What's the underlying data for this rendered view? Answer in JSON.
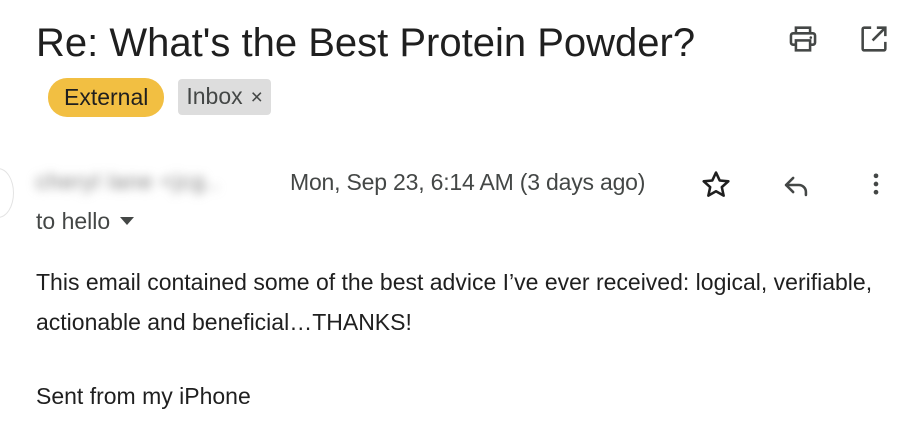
{
  "email": {
    "subject": "Re: What's the Best Protein Powder?",
    "labels": {
      "external": "External",
      "inbox": "Inbox",
      "remove_symbol": "×"
    },
    "sender_name": "cheryl lane <jcg..",
    "date": "Mon, Sep 23, 6:14 AM (3 days ago)",
    "to": "to hello",
    "body": "This email contained some of the best advice I’ve ever received: logical, verifiable, actionable and beneficial…THANKS!",
    "signature": "Sent from my iPhone"
  },
  "icons": {
    "print": "print-icon",
    "popout": "open-in-new-window-icon",
    "star": "star-icon",
    "reply": "reply-icon",
    "more": "more-vertical-icon",
    "to_expand": "chevron-down-icon"
  },
  "colors": {
    "external_badge": "#f2bf42",
    "inbox_badge": "#dddddd",
    "text": "#1f1f1f",
    "secondary_text": "#444746"
  }
}
